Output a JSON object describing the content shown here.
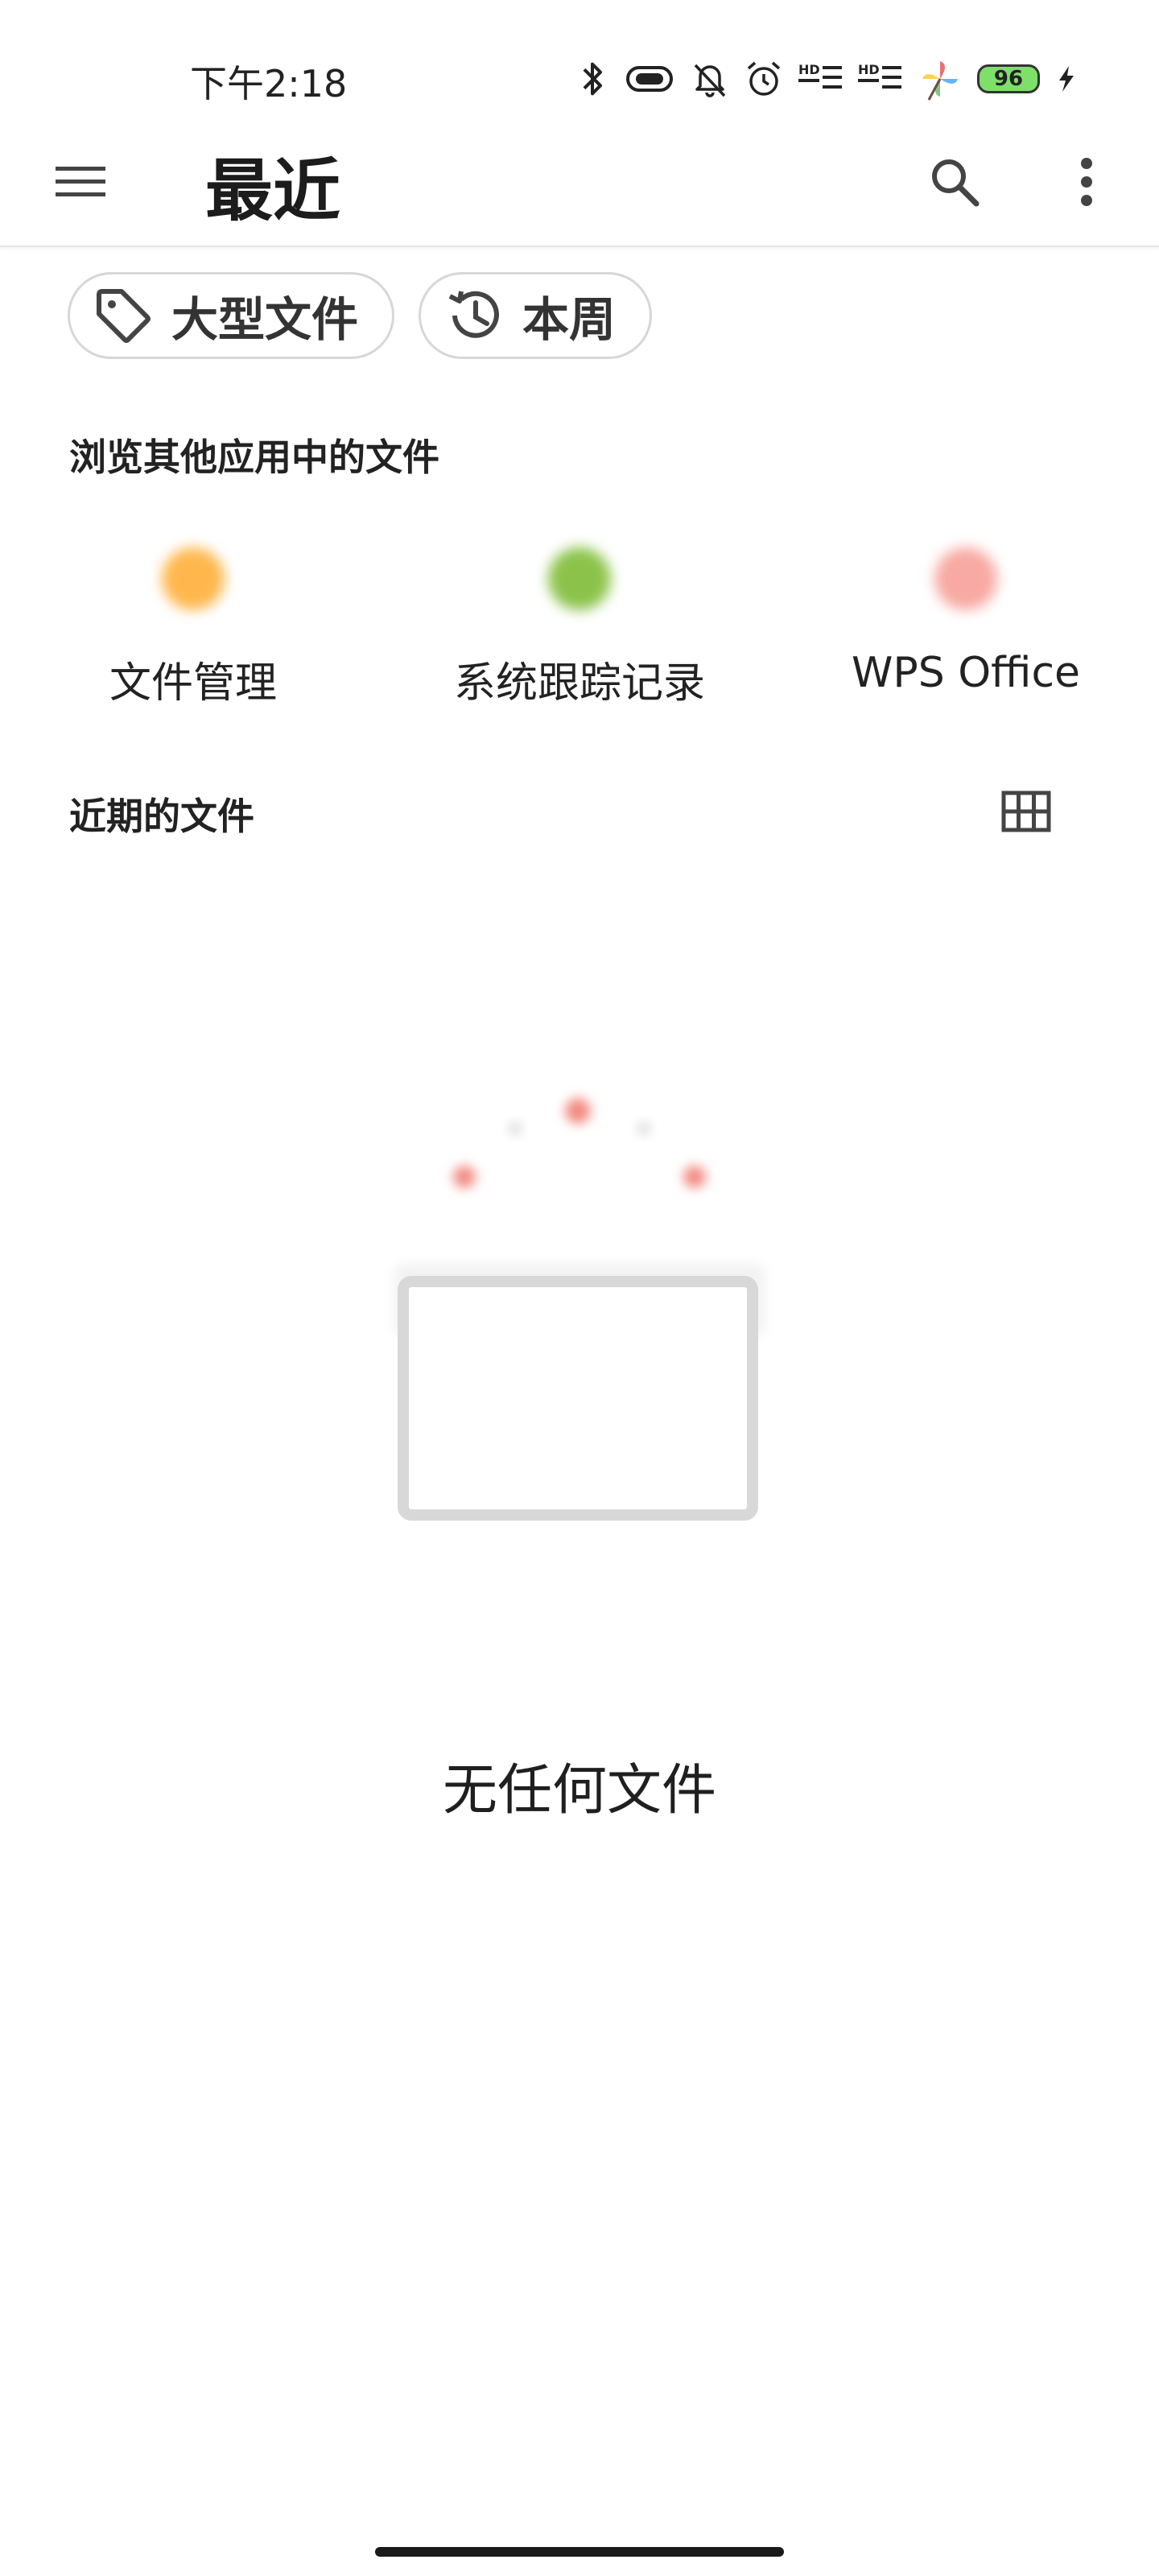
{
  "status_bar": {
    "time": "下午2:18",
    "battery": "96",
    "hd_label": "HD"
  },
  "app_bar": {
    "title": "最近"
  },
  "chips": [
    {
      "label": "大型文件",
      "icon": "tag-icon"
    },
    {
      "label": "本周",
      "icon": "history-icon"
    }
  ],
  "browse_section": {
    "title": "浏览其他应用中的文件",
    "apps": [
      {
        "label": "文件管理",
        "color": "#ffb74d"
      },
      {
        "label": "系统跟踪记录",
        "color": "#8bc34a"
      },
      {
        "label": "WPS Office",
        "color": "#f28b82"
      }
    ]
  },
  "recent_section": {
    "title": "近期的文件"
  },
  "empty_state": {
    "message": "无任何文件"
  },
  "colors": {
    "accent_illustration": "#f28b82",
    "chip_border": "#d7d7d7",
    "icon": "#444444"
  }
}
